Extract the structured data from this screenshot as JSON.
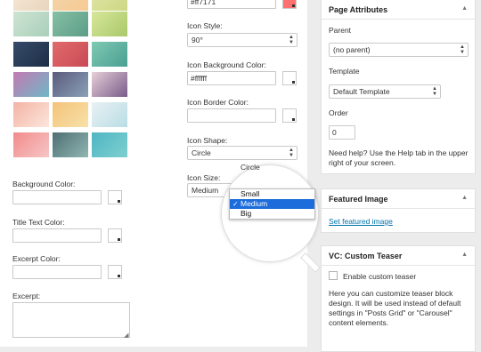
{
  "left": {
    "background_color_label": "Background Color:",
    "title_text_color_label": "Title Text Color:",
    "excerpt_color_label": "Excerpt Color:",
    "excerpt_label": "Excerpt:"
  },
  "icon": {
    "color_value": "#ff7171",
    "style_label": "Icon Style:",
    "style_value": "90°",
    "bg_color_label": "Icon Background Color:",
    "bg_color_value": "#ffffff",
    "border_color_label": "Icon Border Color:",
    "shape_label": "Icon Shape:",
    "shape_value": "Circle",
    "size_label": "Icon Size:",
    "size_value": "Medium",
    "size_options": [
      "Small",
      "Medium",
      "Big"
    ],
    "size_selected": "Medium",
    "magnifier_behind_text": "Circle"
  },
  "page_attributes": {
    "title": "Page Attributes",
    "parent_label": "Parent",
    "parent_value": "(no parent)",
    "template_label": "Template",
    "template_value": "Default Template",
    "order_label": "Order",
    "order_value": "0",
    "help_text": "Need help? Use the Help tab in the upper right of your screen."
  },
  "featured_image": {
    "title": "Featured Image",
    "link": "Set featured image"
  },
  "custom_teaser": {
    "title": "VC: Custom Teaser",
    "checkbox_label": "Enable custom teaser",
    "description": "Here you can customize teaser block design. It will be used instead of default settings in \"Posts Grid\" or \"Carousel\" content elements."
  },
  "colors": {
    "icon_color_swatch": "#ff7171",
    "accent": "#1c6cdb",
    "link": "#0073aa"
  }
}
